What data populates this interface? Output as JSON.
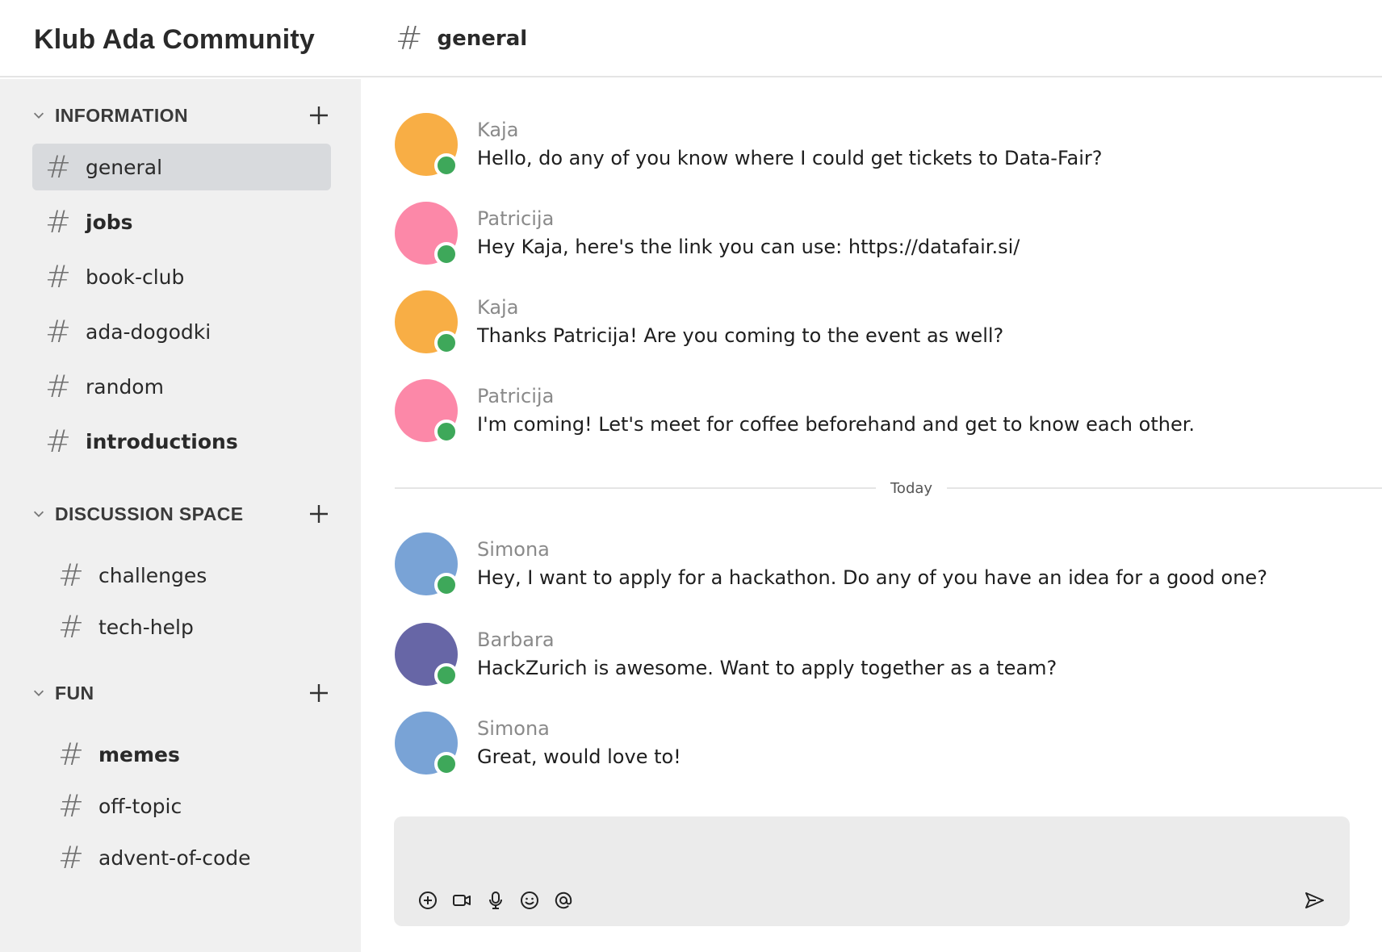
{
  "header": {
    "workspace_title": "Klub Ada Community",
    "channel_hash": "#",
    "channel_name": "general"
  },
  "sidebar": {
    "sections": [
      {
        "label": "INFORMATION",
        "channels": [
          {
            "name": "general",
            "active": true,
            "unread": false
          },
          {
            "name": "jobs",
            "active": false,
            "unread": true
          },
          {
            "name": "book-club",
            "active": false,
            "unread": false
          },
          {
            "name": "ada-dogodki",
            "active": false,
            "unread": false
          },
          {
            "name": "random",
            "active": false,
            "unread": false
          },
          {
            "name": "introductions",
            "active": false,
            "unread": true
          }
        ]
      },
      {
        "label": "DISCUSSION SPACE",
        "channels": [
          {
            "name": "challenges",
            "active": false,
            "unread": false
          },
          {
            "name": "tech-help",
            "active": false,
            "unread": false
          }
        ]
      },
      {
        "label": "FUN",
        "channels": [
          {
            "name": "memes",
            "active": false,
            "unread": true
          },
          {
            "name": "off-topic",
            "active": false,
            "unread": false
          },
          {
            "name": "advent-of-code",
            "active": false,
            "unread": false
          }
        ]
      }
    ],
    "hash": "#"
  },
  "messages": [
    {
      "author": "Kaja",
      "text": "Hello, do any of you know where I could get tickets to Data-Fair?",
      "avatar_color": "#f8ae45"
    },
    {
      "author": "Patricija",
      "text": "Hey Kaja, here's the link you can use: https://datafair.si/",
      "avatar_color": "#fc88a8"
    },
    {
      "author": "Kaja",
      "text": "Thanks Patricija! Are you coming to the event as well?",
      "avatar_color": "#f8ae45"
    },
    {
      "author": "Patricija",
      "text": "I'm coming! Let's meet for coffee beforehand and get to know each other.",
      "avatar_color": "#fc88a8"
    },
    {
      "author": "Simona",
      "text": "Hey, I want to apply for a hackathon. Do any of you have an idea for a good one?",
      "avatar_color": "#79a3d6"
    },
    {
      "author": "Barbara",
      "text": "HackZurich is awesome. Want to apply together as a team?",
      "avatar_color": "#6766a6"
    },
    {
      "author": "Simona",
      "text": "Great, would love to!",
      "avatar_color": "#79a3d6"
    }
  ],
  "divider": {
    "label": "Today"
  },
  "colors": {
    "online_status": "#3ea85a",
    "sidebar_bg": "#f0f0f0",
    "active_channel_bg": "#d8dadd",
    "composer_bg": "#ebebeb"
  },
  "composer": {
    "tools": [
      "add-circle-icon",
      "video-camera-icon",
      "microphone-icon",
      "emoji-icon",
      "mention-icon"
    ],
    "send_icon": "send-icon"
  }
}
